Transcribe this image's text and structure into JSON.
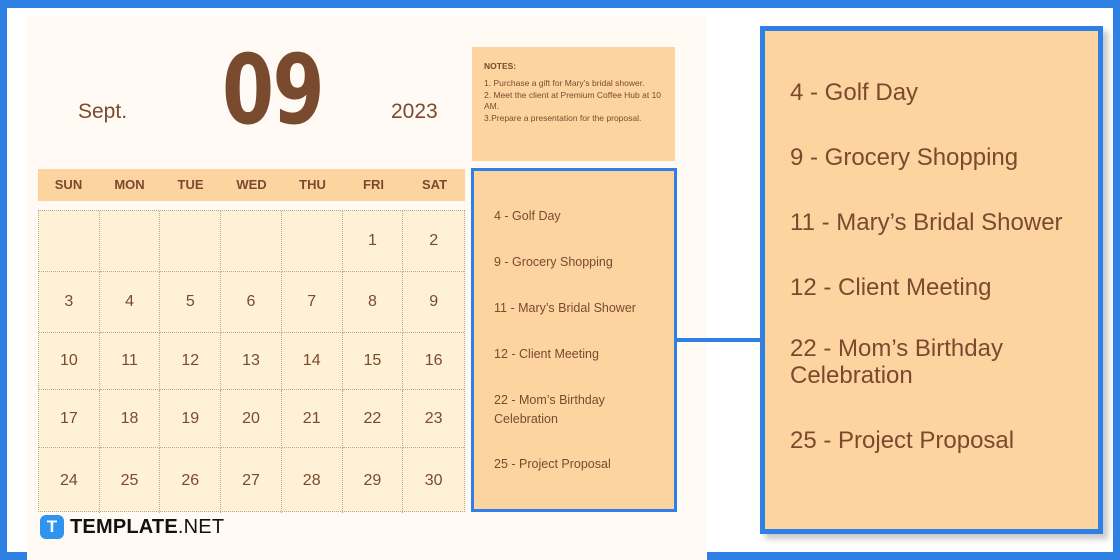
{
  "calendar": {
    "month_label": "Sept.",
    "month_number": "09",
    "year": "2023",
    "weekdays": [
      "SUN",
      "MON",
      "TUE",
      "WED",
      "THU",
      "FRI",
      "SAT"
    ],
    "days": [
      "",
      "",
      "",
      "",
      "",
      "1",
      "2",
      "3",
      "4",
      "5",
      "6",
      "7",
      "8",
      "9",
      "10",
      "11",
      "12",
      "13",
      "14",
      "15",
      "16",
      "17",
      "18",
      "19",
      "20",
      "21",
      "22",
      "23",
      "24",
      "25",
      "26",
      "27",
      "28",
      "29",
      "30"
    ]
  },
  "notes": {
    "title": "NOTES:",
    "items": [
      "1. Purchase a gift for Mary’s bridal shower.",
      "2. Meet the client at Premium Coffee Hub at 10 AM.",
      "3.Prepare a presentation for the proposal."
    ]
  },
  "events": [
    "4 - Golf Day",
    "9 - Grocery Shopping",
    "11 - Mary’s Bridal Shower",
    "12 - Client Meeting",
    "22 - Mom’s Birthday Celebration",
    "25 - Project Proposal"
  ],
  "brand": {
    "logo_letter": "T",
    "name_bold": "TEMPLATE",
    "name_light": ".NET"
  },
  "colors": {
    "accent_blue": "#2f80e4",
    "peach": "#fdd49f",
    "cream": "#fff1d6",
    "brown_text": "#7a4a2e"
  }
}
